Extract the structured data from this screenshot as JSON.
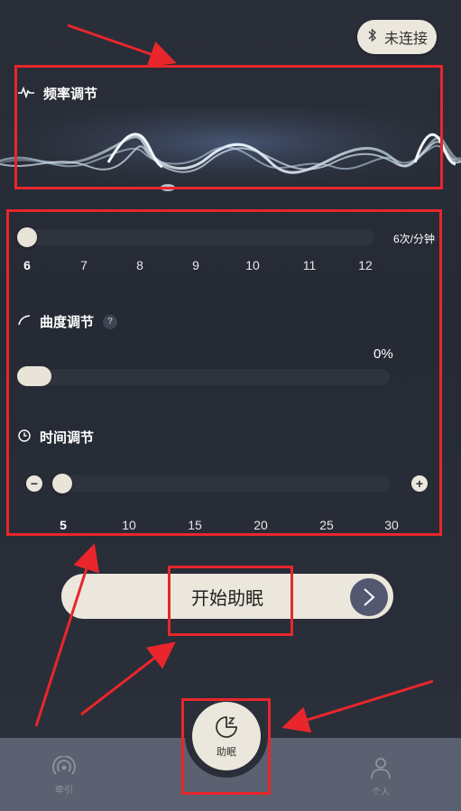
{
  "bluetooth": {
    "label": "未连接",
    "icon": "bluetooth-icon"
  },
  "frequency": {
    "title": "频率调节",
    "unit_value": "6次/分钟",
    "ticks": [
      "6",
      "7",
      "8",
      "9",
      "10",
      "11",
      "12"
    ],
    "selected": 6
  },
  "curve": {
    "title": "曲度调节",
    "help": "?",
    "percent": "0%",
    "value_fraction": 0
  },
  "time": {
    "title": "时间调节",
    "minus": "−",
    "plus": "+",
    "ticks": [
      "5",
      "10",
      "15",
      "20",
      "25",
      "30"
    ],
    "selected": 5
  },
  "start_button": {
    "label": "开始助眠"
  },
  "nav": {
    "left": {
      "label": "牵引",
      "icon": "signal-icon"
    },
    "center": {
      "label": "助眠",
      "icon": "moon-sleep-icon"
    },
    "right": {
      "label": "个人",
      "icon": "person-icon"
    }
  },
  "colors": {
    "accent": "#ece7dc",
    "annotation": "#e8262c",
    "background": "#2a2e38"
  }
}
